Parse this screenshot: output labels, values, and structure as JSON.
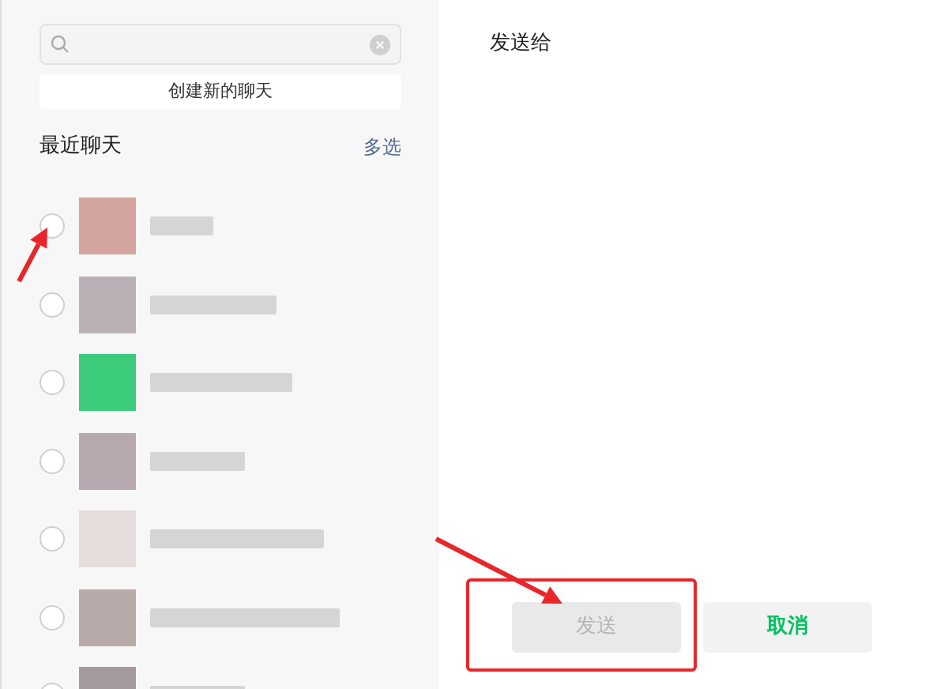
{
  "sidebar": {
    "new_chat_button": "创建新的聊天",
    "section_title": "最近聊天",
    "multi_select_link": "多选",
    "contacts": [
      {
        "selected": false,
        "color": "#d4a59e"
      },
      {
        "selected": false,
        "color": "#b9b1b5"
      },
      {
        "selected": false,
        "color": "#3dcb7c"
      },
      {
        "selected": false,
        "color": "#b8a9b0"
      },
      {
        "selected": false,
        "color": "#e6dcdc"
      },
      {
        "selected": false,
        "color": "#b8aaa8"
      },
      {
        "selected": false,
        "color": "#a49a9c"
      }
    ]
  },
  "main": {
    "title": "发送给",
    "buttons": [
      {
        "kind": "primary",
        "label": "发送",
        "disabled": true
      },
      {
        "kind": "secondary",
        "label": "取消",
        "disabled": false
      }
    ]
  },
  "annotations": [
    {
      "kind": "arrow"
    },
    {
      "kind": "frame"
    },
    {
      "kind": "arrow"
    }
  ]
}
